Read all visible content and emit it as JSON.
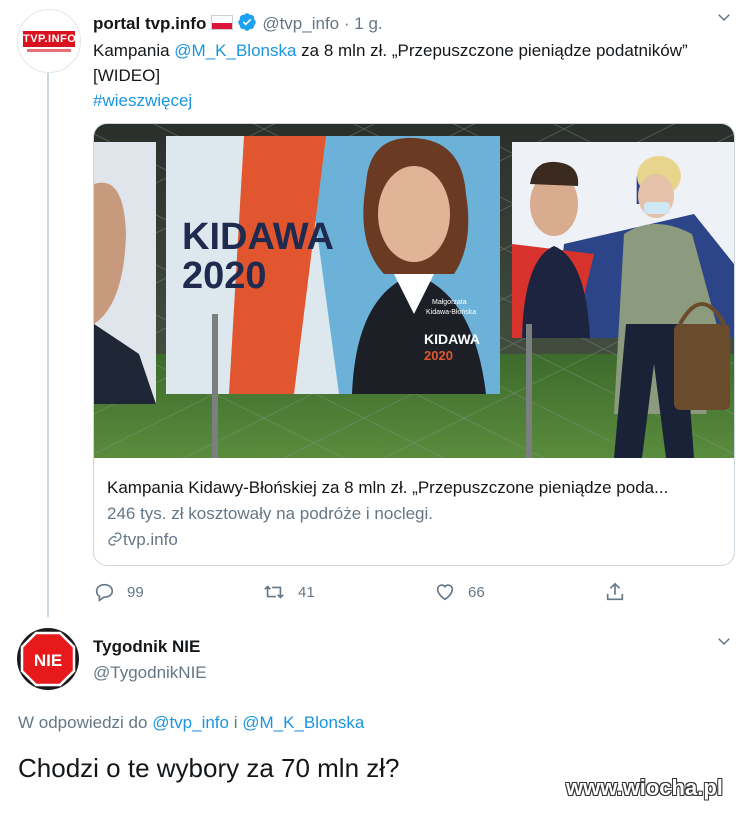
{
  "tweet1": {
    "author_name": "portal tvp.info",
    "handle": "@tvp_info",
    "separator": "·",
    "time": "1 g.",
    "avatar_logo": "TVP.INFO",
    "text_prefix": "Kampania ",
    "mention": "@M_K_Blonska",
    "text_suffix": "  za 8 mln zł. „Przepuszczone pieniądze podatników” [WIDEO]",
    "hashtag": "#wieszwięcej",
    "card": {
      "title": "Kampania Kidawy-Błońskiej za 8 mln zł. „Przepuszczone pieniądze poda...",
      "description": "246 tys. zł kosztowały na podróże i noclegi.",
      "domain": "tvp.info",
      "poster_line1": "KIDAWA",
      "poster_line2": "2020",
      "poster_name_line1": "Małgorzata",
      "poster_name_line2": "Kidawa-Błońska",
      "poster_small_title": "KIDAWA",
      "poster_small_year": "2020"
    },
    "actions": {
      "replies": "99",
      "retweets": "41",
      "likes": "66"
    }
  },
  "tweet2": {
    "author_name": "Tygodnik NIE",
    "handle": "@TygodnikNIE",
    "avatar_logo": "NIE",
    "reply_prefix": "W odpowiedzi do ",
    "reply_mention1": "@tvp_info",
    "reply_and": " i ",
    "reply_mention2": "@M_K_Blonska",
    "text": "Chodzi o te wybory za 70 mln zł?"
  },
  "watermark": "www.wiocha.pl",
  "colors": {
    "link": "#1b95e0",
    "muted": "#657786",
    "border": "#ccd6dd",
    "tvp_red": "#d8121f"
  },
  "icons": [
    "chevron-down-icon",
    "verified-badge-icon",
    "link-icon",
    "reply-icon",
    "retweet-icon",
    "like-icon",
    "share-icon"
  ]
}
